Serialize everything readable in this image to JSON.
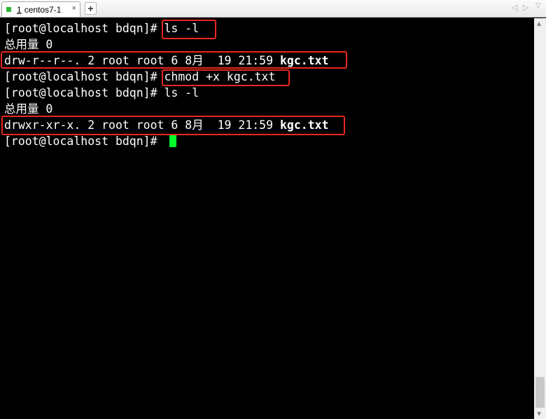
{
  "tabs": [
    {
      "number": "1",
      "title": "centos7-1",
      "close": "×",
      "status_color": "#2fb52f"
    }
  ],
  "add_tab": "+",
  "nav": {
    "prev": "◁",
    "next": "▷",
    "menu": "▽"
  },
  "terminal": {
    "lines": [
      {
        "prompt": "[root@localhost bdqn]# ",
        "command": "ls -l"
      },
      {
        "text": "总用量 0"
      },
      {
        "text": "drw-r--r--. 2 root root 6 8月  19 21:59 ",
        "bold": "kgc.txt"
      },
      {
        "prompt": "[root@localhost bdqn]# ",
        "command": "chmod +x kgc.txt"
      },
      {
        "prompt": "[root@localhost bdqn]# ",
        "command": "ls -l"
      },
      {
        "text": "总用量 0"
      },
      {
        "text": "drwxr-xr-x. 2 root root 6 8月  19 21:59 ",
        "bold": "kgc.txt"
      },
      {
        "prompt": "[root@localhost bdqn]# "
      }
    ],
    "cursor_color": "#00ff2a",
    "highlight_color": "#e8281e"
  }
}
